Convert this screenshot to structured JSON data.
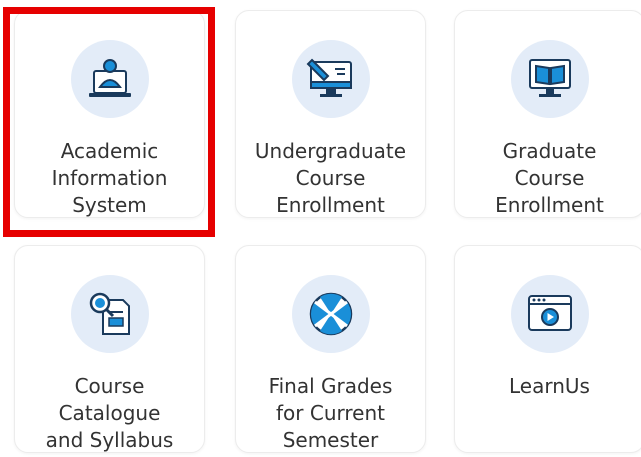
{
  "tiles": [
    {
      "label": "Academic\nInformation\nSystem",
      "icon": "person-at-laptop-icon"
    },
    {
      "label": "Undergraduate\nCourse\nEnrollment",
      "icon": "monitor-pencil-icon"
    },
    {
      "label": "Graduate\nCourse\nEnrollment",
      "icon": "monitor-book-icon"
    },
    {
      "label": "Course\nCatalogue\nand Syllabus",
      "icon": "document-magnifier-icon"
    },
    {
      "label": "Final Grades\nfor Current\nSemester",
      "icon": "grade-badge-icon"
    },
    {
      "label": "LearnUs",
      "icon": "browser-play-icon"
    }
  ],
  "colors": {
    "accent": "#1a8fd8",
    "icon_bg": "#e3ecf8",
    "highlight": "#e60000",
    "text": "#333333"
  }
}
